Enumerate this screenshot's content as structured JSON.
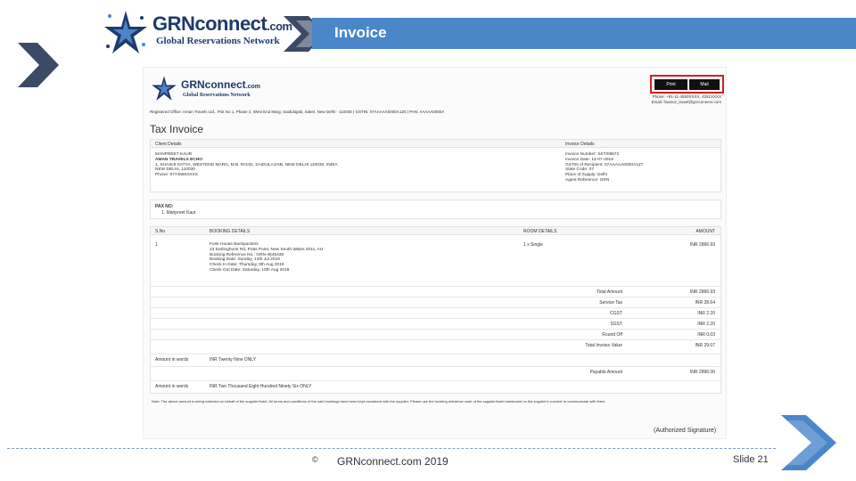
{
  "slide": {
    "logo": {
      "title": "GRNconnect",
      "title_suffix": ".com",
      "subtitle": "Global Reservations Network"
    },
    "header_title": "Invoice",
    "footer": {
      "copyright_symbol": "©",
      "text": "GRNconnect.com 2019",
      "slide_number": "Slide 21"
    },
    "colors": {
      "header_blue": "#4a86c8",
      "brand_navy": "#1f3a6b",
      "chevron_dark": "#3d4a66",
      "chevron_light": "#4a86c8",
      "highlight_red": "#d81e1e"
    }
  },
  "invoice": {
    "logo": {
      "title": "GRNconnect",
      "title_suffix": ".com",
      "subtitle": "Global Reservations Network"
    },
    "buttons": {
      "print": "Print",
      "mail": "Mail"
    },
    "contact": [
      "Phone: +91-11-4550XXXX, 4251XXXX",
      "Email: finance_travel@grnconnect.com"
    ],
    "registered_office": "Registered Office: Aman Travels Ltd., Plot No 1, Phase 2, West End Marg, Saidulajaib, Saket, New Delhi - 110030 | GSTIN: 07AAAAA0000A1Z5 | PAN: AAAAA0000A",
    "title": "Tax Invoice",
    "client_details": {
      "heading": "Client Details",
      "lines": [
        "MANPREET KAUR",
        "AMAN TRAVELS ECHO",
        "1, SHASHI SATYA, WESTEND MARG, M.B. ROAD, SAIDULAJAIB, NEW DELHI 110030, INDIA",
        "NEW DELHI, 110030",
        "Phone: 9774660XXXX"
      ]
    },
    "invoice_details": {
      "heading": "Invoice Details",
      "lines": [
        "Invoice Number: SKT/08572",
        "Invoice Date: 14-07-2019",
        "GSTIN of Recipient: 07AAAAA0000A1Z7",
        "State Code: 07",
        "Place of Supply: Delhi",
        "Agent Reference: GRN"
      ]
    },
    "pax": {
      "heading": "PAX NO:",
      "name": "1. Manpreet Kaur"
    },
    "booking": {
      "headers": {
        "sno": "S.No",
        "details": "BOOKING DETAILS",
        "room": "ROOM DETAILS",
        "amount": "AMOUNT"
      },
      "row": {
        "sno": "1",
        "details": [
          "Funk House Backpackers",
          "23 Darlinghurst Rd, Potts Point, New South Wales 2011, AU",
          "Booking Reference No.: GRN-4545430",
          "Booking Date: Sunday, 14th Jul 2019",
          "Check In Date: Thursday, 8th Aug 2019",
          "Check Out Date: Saturday, 10th Aug 2019"
        ],
        "room": "1 x Single",
        "amount": "INR 2866.93"
      }
    },
    "summary": [
      {
        "label": "Total Amount",
        "value": "INR 2866.93"
      },
      {
        "label": "Service Tax",
        "value": "INR 28.64"
      },
      {
        "label": "CGST",
        "value": "INR 2.20"
      },
      {
        "label": "SGST",
        "value": "INR 2.20"
      },
      {
        "label": "Round Off",
        "value": "INR 0.03"
      },
      {
        "label": "Total Invoice Value",
        "value": "INR 29.07"
      }
    ],
    "amount_words_1": {
      "label": "Amount in words",
      "value": "INR Twenty Nine ONLY"
    },
    "payable": {
      "label": "Payable Amount",
      "value": "INR 2896.00"
    },
    "amount_words_2": {
      "label": "Amount in words",
      "value": "INR Two Thousand Eight Hundred Ninety Six ONLY"
    },
    "note": "Note: The above amount is being collected on behalf of the supplier/hotel. All terms and conditions of the said bookings have been kept consistent with the supplier. Please use the booking reference code of the supplier/hotel mentioned on the supplier's voucher to communicate with them.",
    "signature": "(Authorized Signature)"
  }
}
